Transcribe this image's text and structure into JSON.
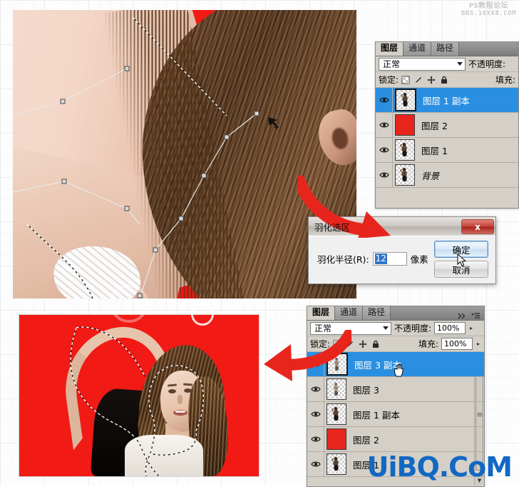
{
  "watermarks": {
    "top_line1": "PS教程论坛",
    "top_line2": "BBS.16XX8.COM",
    "bottom": "UiBQ.CoM"
  },
  "dialog": {
    "title": "羽化选区",
    "close_label": "x",
    "field_label": "羽化半径(R):",
    "field_value": "12",
    "unit": "像素",
    "ok_label": "确定",
    "cancel_label": "取消"
  },
  "panel_top": {
    "tabs": [
      {
        "label": "图层",
        "active": true
      },
      {
        "label": "通道",
        "active": false
      },
      {
        "label": "路径",
        "active": false
      }
    ],
    "blend_mode": "正常",
    "opacity_label": "不透明度:",
    "lock_label": "锁定:",
    "fill_label": "填充:",
    "lock_icons": [
      "lock-transparency-icon",
      "lock-paint-icon",
      "lock-position-icon",
      "lock-all-icon"
    ],
    "layers": [
      {
        "name": "图层 1 副本",
        "selected": true,
        "thumb": "person",
        "italic": false,
        "visible": true
      },
      {
        "name": "图层 2",
        "selected": false,
        "thumb": "red",
        "italic": false,
        "visible": true
      },
      {
        "name": "图层 1",
        "selected": false,
        "thumb": "person",
        "italic": false,
        "visible": true
      },
      {
        "name": "背景",
        "selected": false,
        "thumb": "person",
        "italic": true,
        "visible": true
      }
    ]
  },
  "panel_bottom": {
    "tabs": [
      {
        "label": "图层",
        "active": true
      },
      {
        "label": "通道",
        "active": false
      },
      {
        "label": "路径",
        "active": false
      }
    ],
    "blend_mode": "正常",
    "opacity_label": "不透明度:",
    "opacity_value": "100%",
    "lock_label": "锁定:",
    "fill_label": "填充:",
    "fill_value": "100%",
    "collapse_icon": "double-chevron-right-icon",
    "menu_icon": "panel-menu-icon",
    "layers": [
      {
        "name": "图层 3 副本",
        "selected": true,
        "thumb": "person-cut",
        "visible": true
      },
      {
        "name": "图层 3",
        "selected": false,
        "thumb": "person-cut",
        "visible": true
      },
      {
        "name": "图层 1 副本",
        "selected": false,
        "thumb": "person",
        "visible": true
      },
      {
        "name": "图层 2",
        "selected": false,
        "thumb": "red",
        "visible": true
      },
      {
        "name": "图层 1",
        "selected": false,
        "thumb": "person",
        "visible": true
      }
    ]
  },
  "annotations": {
    "arrow_to_dialog": "red-curved-arrow-down-right",
    "arrow_to_image": "red-curved-arrow-left",
    "cursor_on_ok": "mouse-arrow-cursor",
    "cursor_on_layer": "hand-cursor"
  },
  "photos": {
    "top": "zoomed neck and hair with pen-tool path on red background",
    "bottom": "woman with arm raised, selection marching ants, red background"
  }
}
